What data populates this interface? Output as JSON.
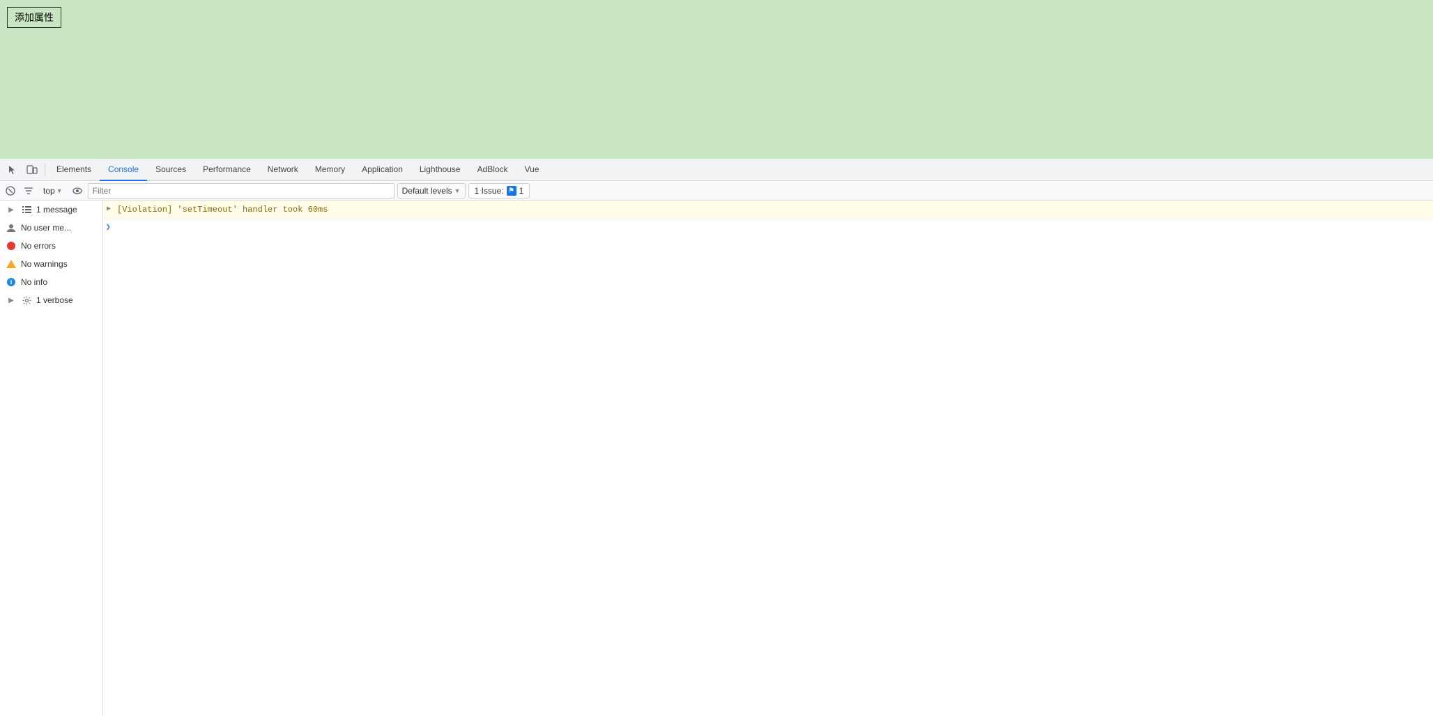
{
  "page": {
    "add_attr_label": "添加属性",
    "bg_color": "#c8e6c1"
  },
  "devtools": {
    "tabs": [
      {
        "id": "elements",
        "label": "Elements",
        "active": false
      },
      {
        "id": "console",
        "label": "Console",
        "active": true
      },
      {
        "id": "sources",
        "label": "Sources",
        "active": false
      },
      {
        "id": "performance",
        "label": "Performance",
        "active": false
      },
      {
        "id": "network",
        "label": "Network",
        "active": false
      },
      {
        "id": "memory",
        "label": "Memory",
        "active": false
      },
      {
        "id": "application",
        "label": "Application",
        "active": false
      },
      {
        "id": "lighthouse",
        "label": "Lighthouse",
        "active": false
      },
      {
        "id": "adblock",
        "label": "AdBlock",
        "active": false
      },
      {
        "id": "vue",
        "label": "Vue",
        "active": false
      }
    ],
    "toolbar": {
      "top_label": "top",
      "filter_placeholder": "Filter",
      "default_levels_label": "Default levels",
      "issues_label": "1 Issue:",
      "issues_count": "1"
    },
    "sidebar": {
      "items": [
        {
          "id": "messages",
          "label": "1 message",
          "icon": "list",
          "expandable": true,
          "active": false
        },
        {
          "id": "user",
          "label": "No user me...",
          "icon": "user",
          "expandable": false
        },
        {
          "id": "errors",
          "label": "No errors",
          "icon": "error",
          "expandable": false
        },
        {
          "id": "warnings",
          "label": "No warnings",
          "icon": "warning",
          "expandable": false
        },
        {
          "id": "info",
          "label": "No info",
          "icon": "info",
          "expandable": false
        },
        {
          "id": "verbose",
          "label": "1 verbose",
          "icon": "gear",
          "expandable": true
        }
      ]
    },
    "console_messages": [
      {
        "id": "violation",
        "text": "[Violation] 'setTimeout' handler took 60ms",
        "type": "warning"
      }
    ]
  }
}
